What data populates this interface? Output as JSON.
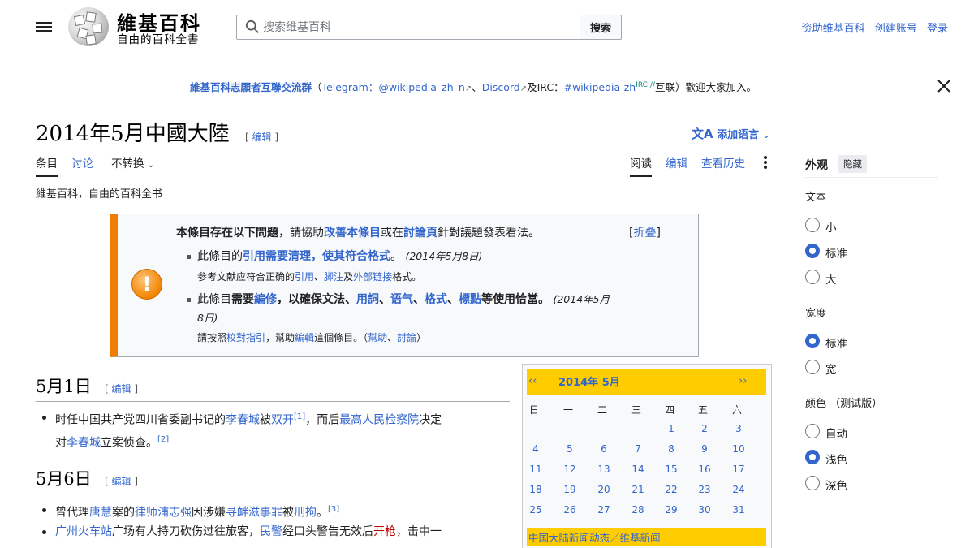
{
  "header": {
    "site_title": "維基百科",
    "site_subtitle": "自由的百科全書",
    "search_placeholder": "搜索维基百科",
    "search_button": "搜索",
    "user_links": [
      "资助维基百科",
      "创建账号",
      "登录"
    ]
  },
  "banner": {
    "group": "維基百科志願者互聯交流群",
    "open_paren": "（",
    "telegram": "Telegram：",
    "telegram_handle": "@wikipedia_zh_n",
    "sep1": "、",
    "discord": "Discord",
    "and_irc": "及IRC：",
    "irc_channel": "#wikipedia-zh",
    "irc_sup": "IRC://",
    "tail": "互联）歡迎大家加入。"
  },
  "article": {
    "title": "2014年5月中國大陸",
    "edit_label": "编辑",
    "add_languages": "添加语言",
    "site_sub": "維基百科，自由的百科全书"
  },
  "tabs": {
    "left": [
      "条目",
      "讨论",
      "不转换"
    ],
    "right": [
      "阅读",
      "编辑",
      "查看历史"
    ]
  },
  "ambox": {
    "head_bold": "本條目存在以下問題",
    "head_rest1": "，請協助",
    "head_link1": "改善本條目",
    "head_rest2": "或在",
    "head_link2": "討論頁",
    "head_rest3": "針對議題發表看法。",
    "collapse_open": "[",
    "collapse_label": "折叠",
    "collapse_close": "]",
    "item1_pre": "此條目的",
    "item1_link": "引用需要清理，使其符合格式",
    "item1_post": "。",
    "item1_date": "(2014年5月8日)",
    "item1_sub_pre": "参考文献应符合正确的",
    "item1_sub_l1": "引用",
    "item1_sub_s1": "、",
    "item1_sub_l2": "脚注",
    "item1_sub_s2": "及",
    "item1_sub_l3": "外部链接",
    "item1_sub_post": "格式。",
    "item2_pre": "此條目",
    "item2_b1": "需要",
    "item2_link1": "編修",
    "item2_b2": "，以確保文法、",
    "item2_link2": "用詞",
    "item2_s1": "、",
    "item2_link3": "语气",
    "item2_s2": "、",
    "item2_link4": "格式",
    "item2_s3": "、",
    "item2_link5": "標點",
    "item2_b3": "等使用恰當。",
    "item2_date_a": "(2014年5月",
    "item2_date_b": "8日)",
    "item2_sub_pre": "請按照",
    "item2_sub_l1": "校對指引",
    "item2_sub_mid": "，幫助",
    "item2_sub_l2": "編輯",
    "item2_sub_mid2": "這個條目。（",
    "item2_sub_l3": "幫助",
    "item2_sub_s": "、",
    "item2_sub_l4": "討論",
    "item2_sub_post": "）"
  },
  "sections": [
    {
      "heading": "5月1日",
      "edit": "编辑",
      "item": {
        "t1": "时任中国共产党四川省委副书记的",
        "l1": "李春城",
        "t2": "被",
        "l2": "双开",
        "ref1": "[1]",
        "t3": "，而后",
        "l3": "最高人民检察院",
        "t4": "决定",
        "t5": "对",
        "l4": "李春城",
        "t6": "立案侦查。",
        "ref2": "[2]"
      }
    },
    {
      "heading": "5月6日",
      "edit": "编辑",
      "item1": {
        "t1": "曾代理",
        "l1": "唐慧",
        "t2": "案的",
        "l2": "律师浦志强",
        "t3": "因涉嫌",
        "l3": "寻衅滋事罪",
        "t4": "被",
        "l4": "刑拘",
        "t5": "。",
        "ref": "[3]"
      },
      "item2": {
        "l1": "广州火车站",
        "t1": "广场有人持刀砍伤过往旅客，",
        "l2": "民警",
        "t2": "经口头警告无效后",
        "l3": "开枪",
        "t3": "，击中一"
      }
    }
  ],
  "calendar": {
    "prev": "‹‹",
    "next": "››",
    "title": "2014年 5月",
    "weekdays": [
      "日",
      "一",
      "二",
      "三",
      "四",
      "五",
      "六"
    ],
    "rows": [
      [
        "",
        "",
        "",
        "",
        "1",
        "2",
        "3"
      ],
      [
        "4",
        "5",
        "6",
        "7",
        "8",
        "9",
        "10"
      ],
      [
        "11",
        "12",
        "13",
        "14",
        "15",
        "16",
        "17"
      ],
      [
        "18",
        "19",
        "20",
        "21",
        "22",
        "23",
        "24"
      ],
      [
        "25",
        "26",
        "27",
        "28",
        "29",
        "30",
        "31"
      ]
    ],
    "footer": "中国大陆新闻动态／维基新闻"
  },
  "appearance": {
    "title": "外观",
    "hide": "隐藏",
    "text_label": "文本",
    "text_options": [
      "小",
      "标准",
      "大"
    ],
    "text_selected": 1,
    "width_label": "宽度",
    "width_options": [
      "标准",
      "宽"
    ],
    "width_selected": 0,
    "color_label": "颜色 （测试版）",
    "color_options": [
      "自动",
      "浅色",
      "深色"
    ],
    "color_selected": 1
  }
}
